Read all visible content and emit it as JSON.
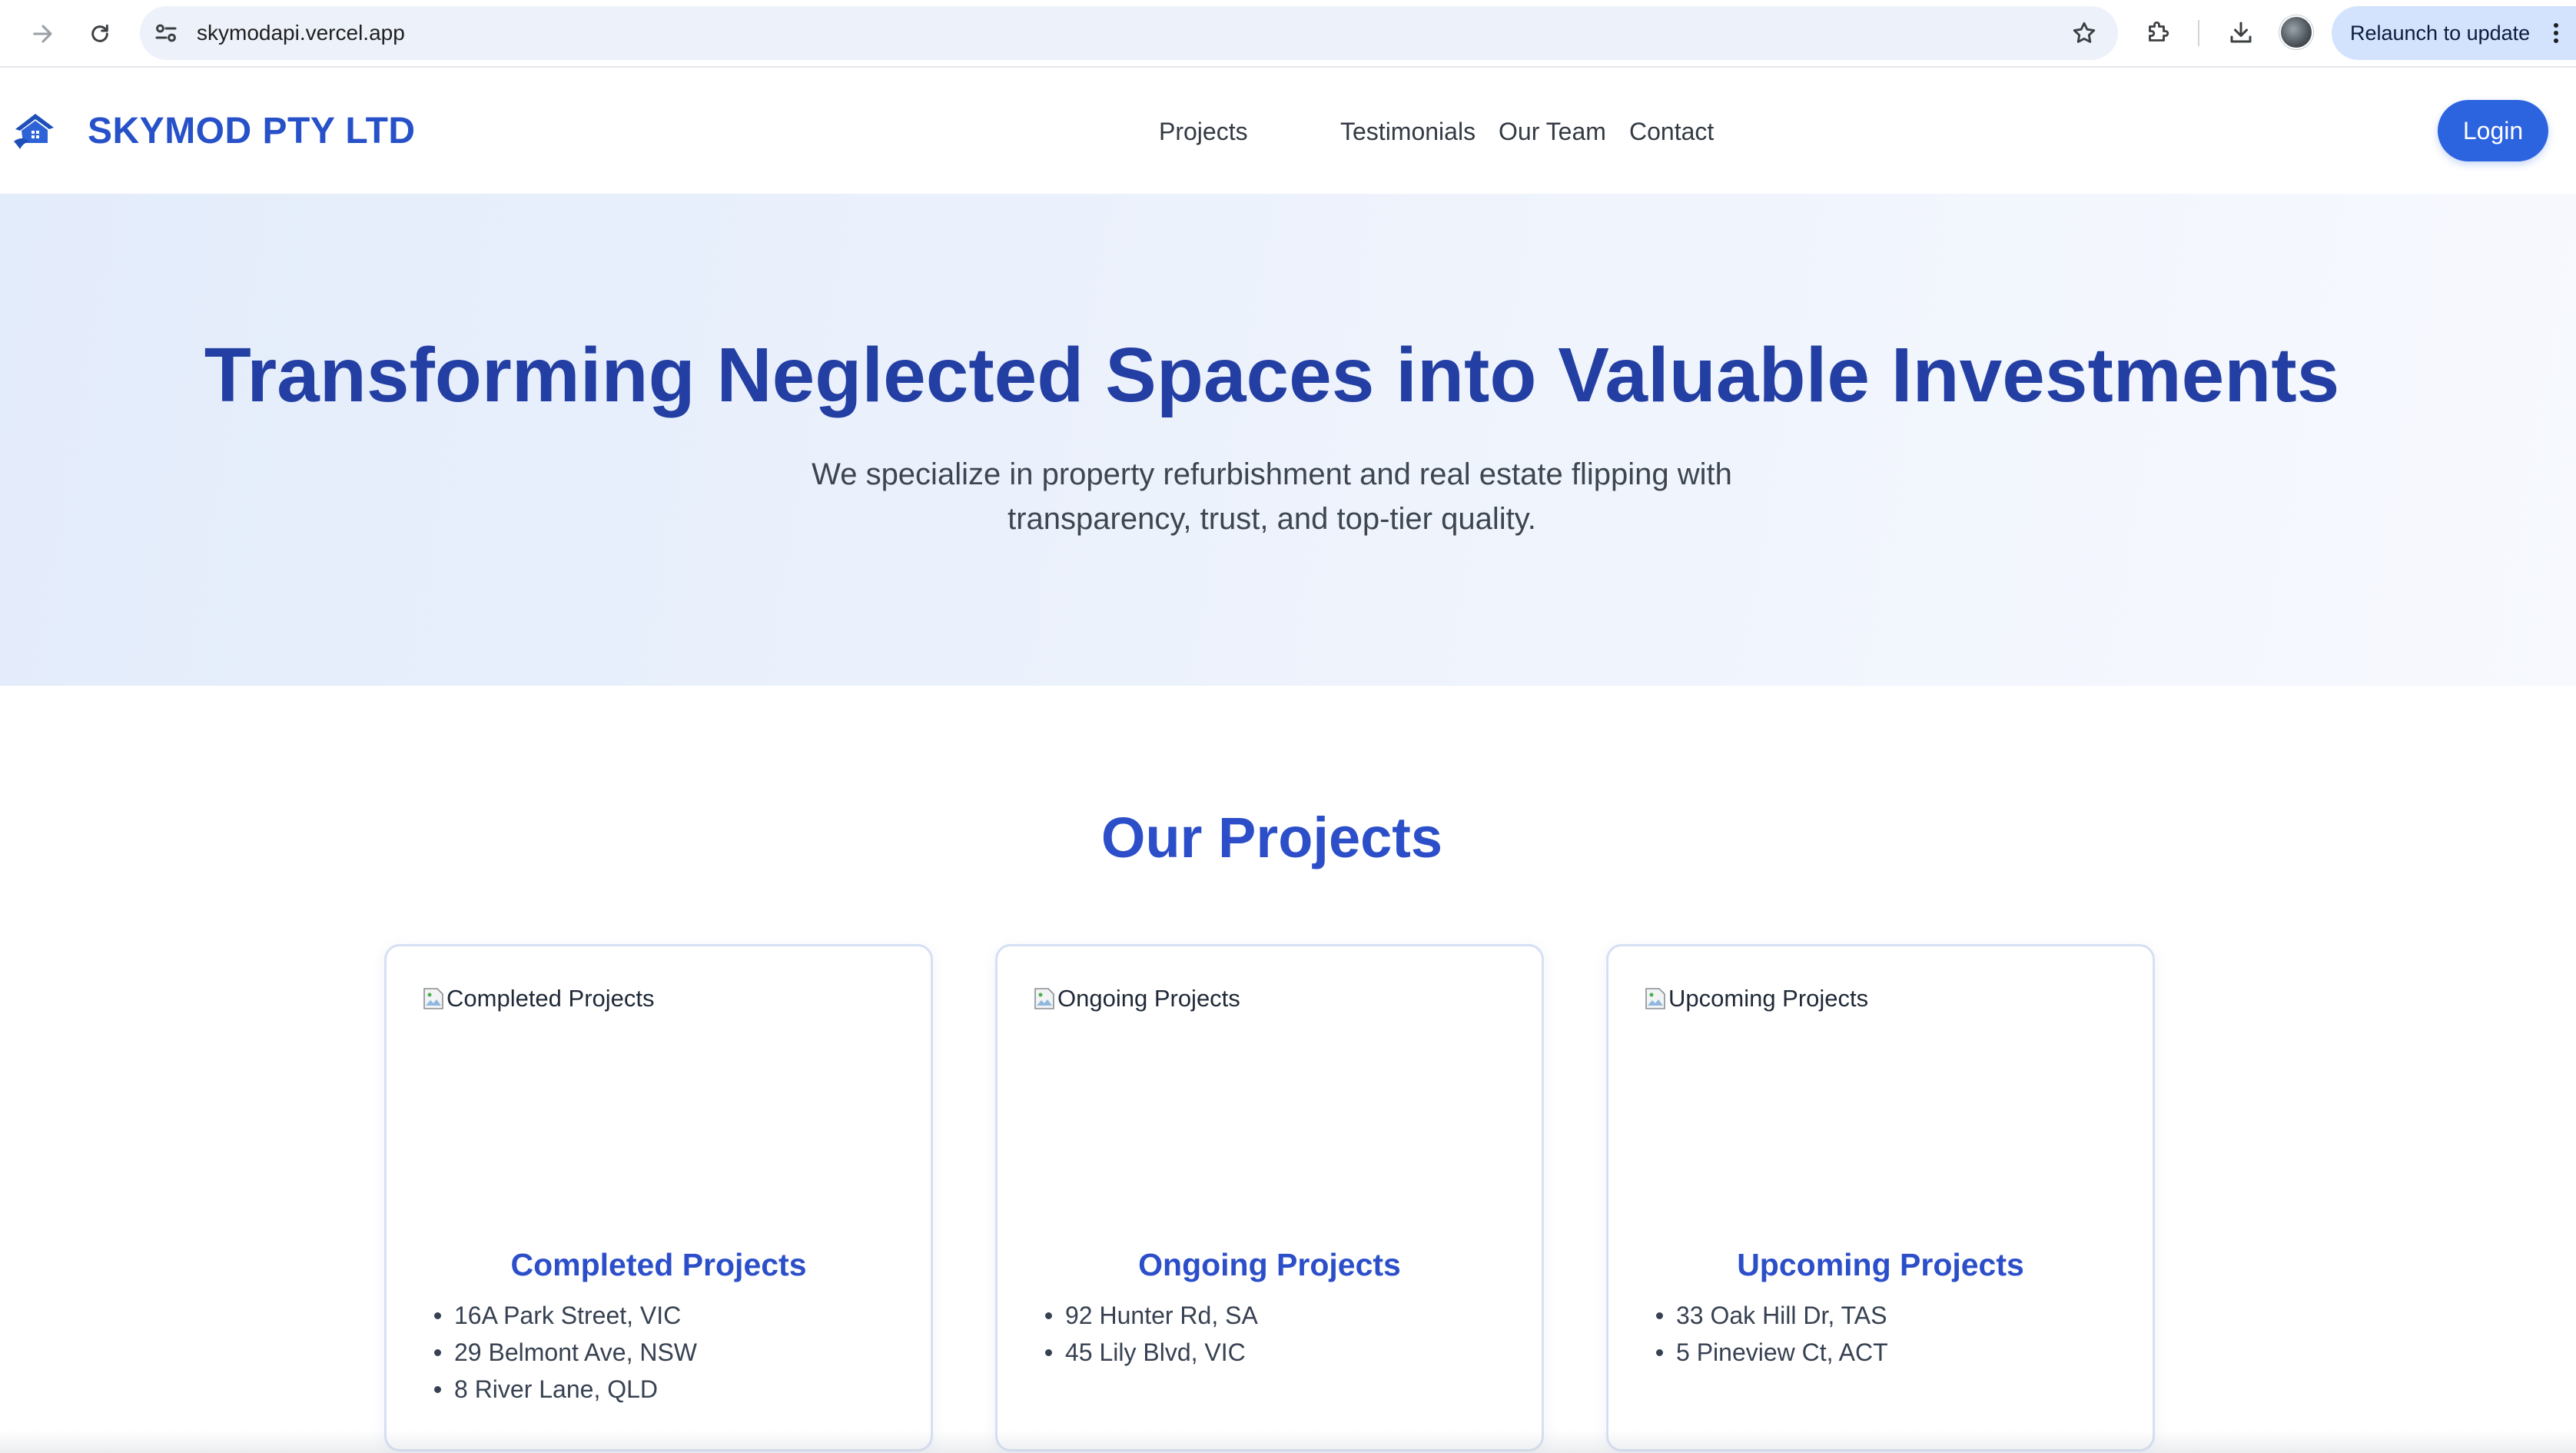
{
  "browser": {
    "url": "skymodapi.vercel.app",
    "relaunch_label": "Relaunch to update"
  },
  "header": {
    "brand": "SKYMOD PTY LTD",
    "nav": [
      "Projects",
      "Testimonials",
      "Our Team",
      "Contact"
    ],
    "login_label": "Login",
    "brand_color": "#2751c9",
    "accent_color": "#2c63df"
  },
  "hero": {
    "title": "Transforming Neglected Spaces into Valuable Investments",
    "subtitle_line1": "We specialize in property refurbishment and real estate flipping with",
    "subtitle_line2": "transparency, trust, and top-tier quality."
  },
  "projects": {
    "title": "Our Projects",
    "cards": [
      {
        "image_alt": "Completed Projects",
        "heading": "Completed Projects",
        "items": [
          "16A Park Street, VIC",
          "29 Belmont Ave, NSW",
          "8 River Lane, QLD"
        ]
      },
      {
        "image_alt": "Ongoing Projects",
        "heading": "Ongoing Projects",
        "items": [
          "92 Hunter Rd, SA",
          "45 Lily Blvd, VIC"
        ]
      },
      {
        "image_alt": "Upcoming Projects",
        "heading": "Upcoming Projects",
        "items": [
          "33 Oak Hill Dr, TAS",
          "5 Pineview Ct, ACT"
        ]
      }
    ]
  },
  "icons": {
    "back": "arrow-forward-icon",
    "reload": "reload-icon",
    "site_info": "tune-icon",
    "bookmark": "star-icon",
    "extensions": "puzzle-icon",
    "downloads": "download-icon",
    "menu": "kebab-icon",
    "logo": "house-logo-icon",
    "broken_image": "broken-image-icon"
  }
}
